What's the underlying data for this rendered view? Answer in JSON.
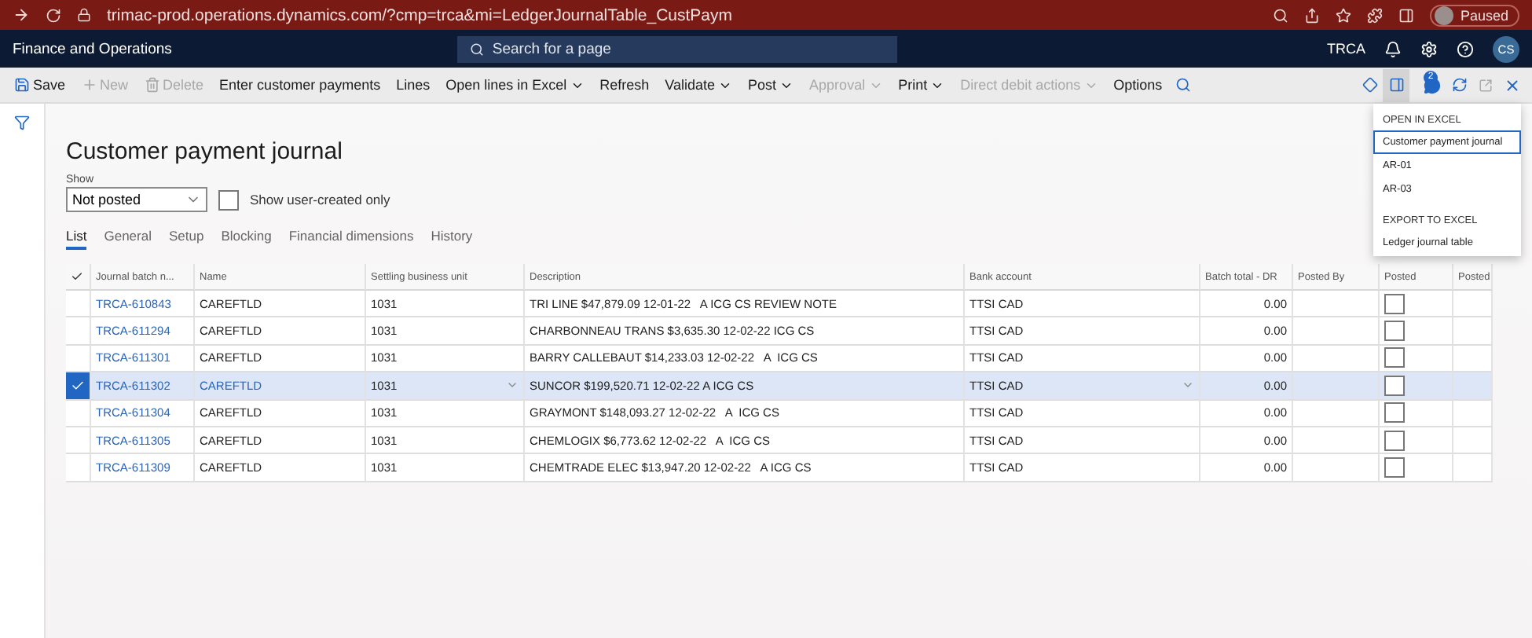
{
  "browser": {
    "url": "trimac-prod.operations.dynamics.com/?cmp=trca&mi=LedgerJournalTable_CustPaym",
    "profile_status": "Paused"
  },
  "header": {
    "app_name": "Finance and Operations",
    "search_placeholder": "Search for a page",
    "company": "TRCA",
    "avatar_initials": "CS"
  },
  "toolbar": {
    "items": [
      {
        "label": "Save",
        "disabled": false,
        "dropdown": false
      },
      {
        "label": "New",
        "disabled": true,
        "dropdown": false
      },
      {
        "label": "Delete",
        "disabled": true,
        "dropdown": false
      },
      {
        "label": "Enter customer payments",
        "disabled": false,
        "dropdown": false
      },
      {
        "label": "Lines",
        "disabled": false,
        "dropdown": false
      },
      {
        "label": "Open lines in Excel",
        "disabled": false,
        "dropdown": true
      },
      {
        "label": "Refresh",
        "disabled": false,
        "dropdown": false
      },
      {
        "label": "Validate",
        "disabled": false,
        "dropdown": true
      },
      {
        "label": "Post",
        "disabled": false,
        "dropdown": true
      },
      {
        "label": "Approval",
        "disabled": true,
        "dropdown": true
      },
      {
        "label": "Print",
        "disabled": false,
        "dropdown": true
      },
      {
        "label": "Direct debit actions",
        "disabled": true,
        "dropdown": true
      },
      {
        "label": "Options",
        "disabled": false,
        "dropdown": false
      }
    ],
    "message_count": "2"
  },
  "page": {
    "title": "Customer payment journal",
    "show_label": "Show",
    "show_value": "Not posted",
    "user_created_only": {
      "label": "Show user-created only",
      "checked": false
    }
  },
  "tabs": [
    {
      "label": "List",
      "selected": true
    },
    {
      "label": "General",
      "selected": false
    },
    {
      "label": "Setup",
      "selected": false
    },
    {
      "label": "Blocking",
      "selected": false
    },
    {
      "label": "Financial dimensions",
      "selected": false
    },
    {
      "label": "History",
      "selected": false
    }
  ],
  "table": {
    "columns": [
      "Journal batch n...",
      "Name",
      "Settling business unit",
      "Description",
      "Bank account",
      "Batch total - DR",
      "Posted By",
      "Posted",
      "Posted"
    ],
    "rows": [
      {
        "selected": false,
        "batch": "TRCA-610843",
        "name": "CAREFTLD",
        "unit": "1031",
        "description": "TRI LINE $47,879.09 12-01-22   A ICG CS REVIEW NOTE",
        "bank": "TTSI CAD",
        "total": "0.00",
        "posted": false
      },
      {
        "selected": false,
        "batch": "TRCA-611294",
        "name": "CAREFTLD",
        "unit": "1031",
        "description": "CHARBONNEAU TRANS $3,635.30 12-02-22 ICG CS",
        "bank": "TTSI CAD",
        "total": "0.00",
        "posted": false
      },
      {
        "selected": false,
        "batch": "TRCA-611301",
        "name": "CAREFTLD",
        "unit": "1031",
        "description": "BARRY CALLEBAUT $14,233.03 12-02-22   A  ICG CS",
        "bank": "TTSI CAD",
        "total": "0.00",
        "posted": false
      },
      {
        "selected": true,
        "batch": "TRCA-611302",
        "name": "CAREFTLD",
        "unit": "1031",
        "description": "SUNCOR $199,520.71 12-02-22 A ICG CS",
        "bank": "TTSI CAD",
        "total": "0.00",
        "posted": false
      },
      {
        "selected": false,
        "batch": "TRCA-611304",
        "name": "CAREFTLD",
        "unit": "1031",
        "description": "GRAYMONT $148,093.27 12-02-22   A  ICG CS",
        "bank": "TTSI CAD",
        "total": "0.00",
        "posted": false
      },
      {
        "selected": false,
        "batch": "TRCA-611305",
        "name": "CAREFTLD",
        "unit": "1031",
        "description": "CHEMLOGIX $6,773.62 12-02-22   A  ICG CS",
        "bank": "TTSI CAD",
        "total": "0.00",
        "posted": false
      },
      {
        "selected": false,
        "batch": "TRCA-611309",
        "name": "CAREFTLD",
        "unit": "1031",
        "description": "CHEMTRADE ELEC $13,947.20 12-02-22   A ICG CS",
        "bank": "TTSI CAD",
        "total": "0.00",
        "posted": false
      }
    ]
  },
  "excel_menu": {
    "sections": [
      {
        "heading": "OPEN IN EXCEL",
        "items": [
          {
            "label": "Customer payment journal",
            "selected": true
          },
          {
            "label": "AR-01",
            "selected": false
          },
          {
            "label": "AR-03",
            "selected": false
          }
        ]
      },
      {
        "heading": "EXPORT TO EXCEL",
        "items": [
          {
            "label": "Ledger journal table",
            "selected": false
          }
        ]
      }
    ]
  }
}
